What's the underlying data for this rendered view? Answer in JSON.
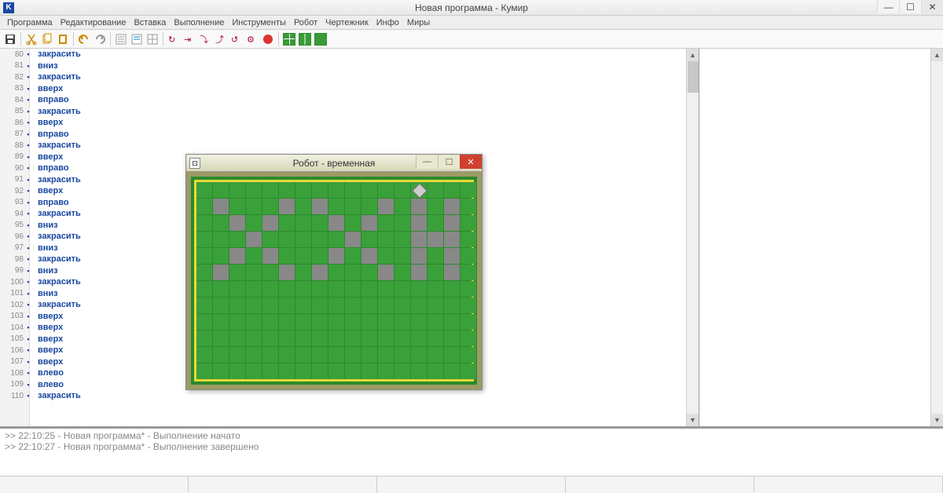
{
  "window": {
    "title": "Новая программа - Кумир",
    "icon_letter": "K"
  },
  "menu": [
    "Программа",
    "Редактирование",
    "Вставка",
    "Выполнение",
    "Инструменты",
    "Робот",
    "Чертежник",
    "Инфо",
    "Миры"
  ],
  "code": [
    {
      "n": 80,
      "t": "закрасить"
    },
    {
      "n": 81,
      "t": "вниз"
    },
    {
      "n": 82,
      "t": "закрасить"
    },
    {
      "n": 83,
      "t": "вверх"
    },
    {
      "n": 84,
      "t": "вправо"
    },
    {
      "n": 85,
      "t": "закрасить"
    },
    {
      "n": 86,
      "t": "вверх"
    },
    {
      "n": 87,
      "t": "вправо"
    },
    {
      "n": 88,
      "t": "закрасить"
    },
    {
      "n": 89,
      "t": "вверх"
    },
    {
      "n": 90,
      "t": "вправо"
    },
    {
      "n": 91,
      "t": "закрасить"
    },
    {
      "n": 92,
      "t": "вверх"
    },
    {
      "n": 93,
      "t": "вправо"
    },
    {
      "n": 94,
      "t": "закрасить"
    },
    {
      "n": 95,
      "t": "вниз"
    },
    {
      "n": 96,
      "t": "закрасить"
    },
    {
      "n": 97,
      "t": "вниз"
    },
    {
      "n": 98,
      "t": "закрасить"
    },
    {
      "n": 99,
      "t": "вниз"
    },
    {
      "n": 100,
      "t": "закрасить"
    },
    {
      "n": 101,
      "t": "вниз"
    },
    {
      "n": 102,
      "t": "закрасить"
    },
    {
      "n": 103,
      "t": "вверх"
    },
    {
      "n": 104,
      "t": "вверх"
    },
    {
      "n": 105,
      "t": "вверх"
    },
    {
      "n": 106,
      "t": "вверх"
    },
    {
      "n": 107,
      "t": "вверх"
    },
    {
      "n": 108,
      "t": "влево"
    },
    {
      "n": 109,
      "t": "влево"
    },
    {
      "n": 110,
      "t": "закрасить"
    }
  ],
  "robot_window": {
    "title": "Робот - временная",
    "cols": 17,
    "rows": 12,
    "robot_pos": [
      0,
      13
    ],
    "gray_cells": [
      [
        1,
        1
      ],
      [
        1,
        5
      ],
      [
        1,
        7
      ],
      [
        1,
        11
      ],
      [
        1,
        13
      ],
      [
        1,
        15
      ],
      [
        2,
        2
      ],
      [
        2,
        4
      ],
      [
        2,
        8
      ],
      [
        2,
        10
      ],
      [
        2,
        13
      ],
      [
        2,
        15
      ],
      [
        3,
        3
      ],
      [
        3,
        9
      ],
      [
        3,
        13
      ],
      [
        3,
        14
      ],
      [
        3,
        15
      ],
      [
        4,
        2
      ],
      [
        4,
        4
      ],
      [
        4,
        8
      ],
      [
        4,
        10
      ],
      [
        4,
        13
      ],
      [
        4,
        15
      ],
      [
        5,
        1
      ],
      [
        5,
        5
      ],
      [
        5,
        7
      ],
      [
        5,
        11
      ],
      [
        5,
        13
      ],
      [
        5,
        15
      ]
    ]
  },
  "console": [
    ">> 22:10:25 - Новая программа* - Выполнение начато",
    ">> 22:10:27 - Новая программа* - Выполнение завершено"
  ]
}
